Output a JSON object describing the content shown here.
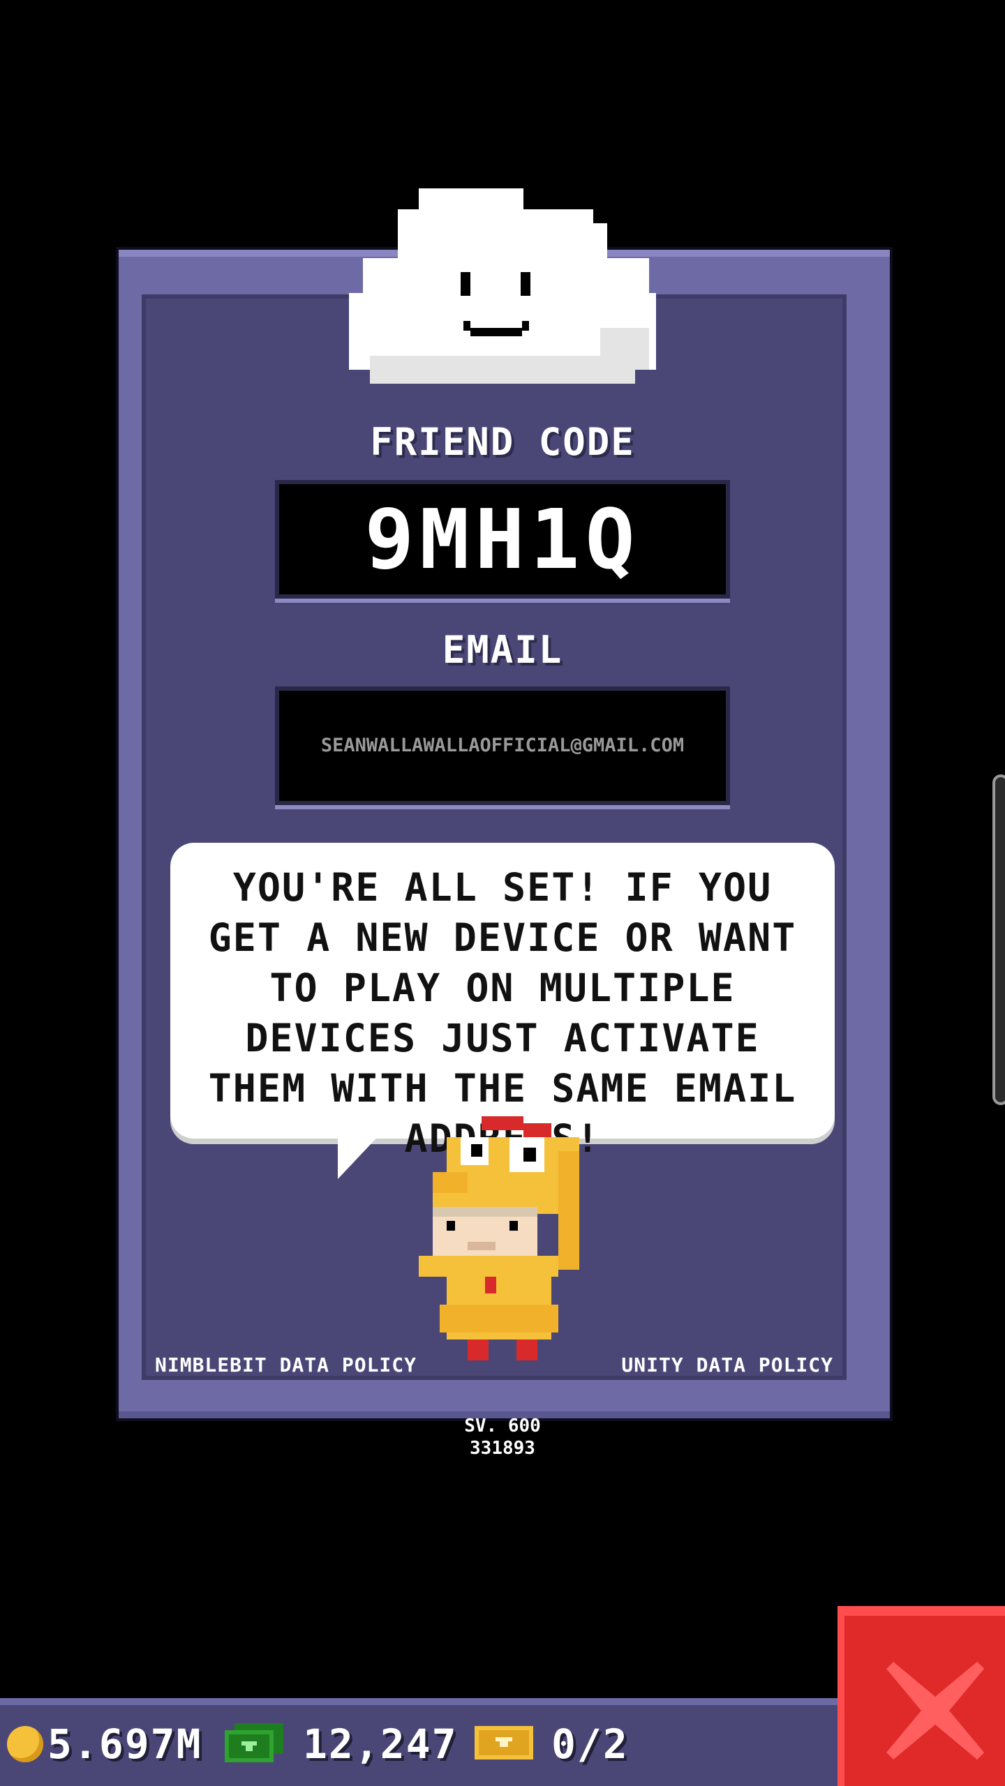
{
  "friend_code": {
    "label": "FRIEND CODE",
    "value": "9MH1Q"
  },
  "email": {
    "label": "EMAIL",
    "value": "SEANWALLAWALLAOFFICIAL@GMAIL.COM"
  },
  "message": "YOU'RE ALL SET! IF YOU GET A NEW DEVICE OR WANT TO PLAY ON MULTIPLE DEVICES JUST ACTIVATE THEM WITH THE SAME EMAIL ADDRESS!",
  "links": {
    "nimblebit_policy": "NIMBLEBIT DATA POLICY",
    "unity_policy": "UNITY DATA POLICY"
  },
  "version": {
    "line1": "SV. 600",
    "line2": "331893"
  },
  "bottom_bar": {
    "coins": "5.697M",
    "bux": "12,247",
    "tickets": "0/2"
  },
  "icons": {
    "coin": "coin-icon",
    "bux": "bux-icon",
    "ticket": "ticket-icon",
    "close": "close-icon",
    "cloud": "cloud-mascot-icon",
    "character": "chicken-costume-character"
  },
  "colors": {
    "panel": "#6d6aa5",
    "panel_inner": "#4a4777",
    "close_button": "#e02a2a",
    "coin": "#f6c13a",
    "bux": "#2fa32f"
  }
}
